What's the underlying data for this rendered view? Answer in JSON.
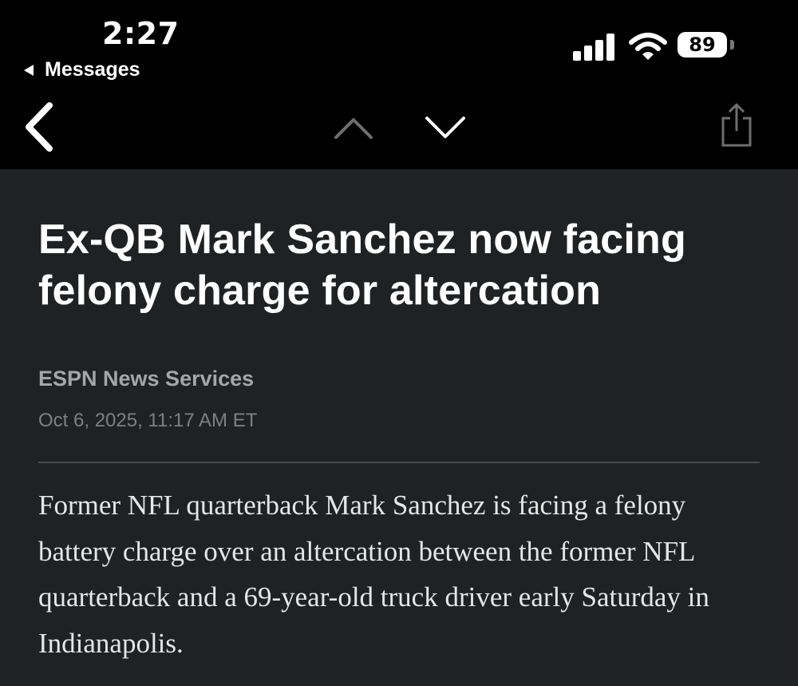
{
  "status_bar": {
    "time": "2:27",
    "back_app": "Messages",
    "battery": "89",
    "icons": [
      "cellular-signal-icon",
      "wifi-icon",
      "battery-icon"
    ]
  },
  "nav": {
    "icons": [
      "chevron-left-icon",
      "chevron-up-icon",
      "chevron-down-icon",
      "share-icon"
    ]
  },
  "article": {
    "headline": "Ex-QB Mark Sanchez now facing felony charge for altercation",
    "byline": "ESPN News Services",
    "date": "Oct 6, 2025, 11:17 AM ET",
    "body": "Former NFL quarterback Mark Sanchez is facing a felony battery charge over an altercation between the former NFL quarterback and a 69-year-old truck driver early Saturday in Indianapolis."
  },
  "colors": {
    "top_bar": "#000000",
    "page_background": "#1f2123",
    "headline": "#ffffff",
    "byline": "#a4a6a8",
    "date": "#7d8083",
    "body": "#e6e6e6"
  }
}
